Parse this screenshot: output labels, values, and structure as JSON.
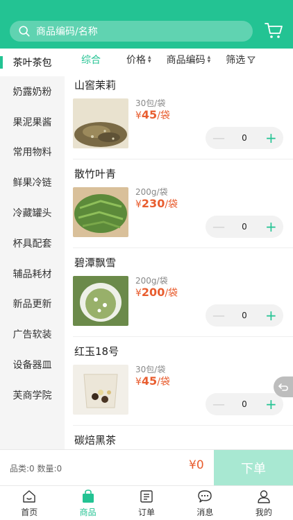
{
  "header": {
    "search_placeholder": "商品编码/名称",
    "search_icon": "search-icon",
    "cart_icon": "cart-icon"
  },
  "filters": {
    "all": "综合",
    "price": "价格",
    "code": "商品编码",
    "filter": "筛选"
  },
  "sidebar": {
    "items": [
      "茶叶茶包",
      "奶露奶粉",
      "果泥果酱",
      "常用物料",
      "鲜果冷链",
      "冷藏罐头",
      "杯具配套",
      "辅品耗材",
      "新品更新",
      "广告软装",
      "设备器皿",
      "芙商学院"
    ],
    "active_index": 0
  },
  "products": [
    {
      "name": "山窖茉莉",
      "spec": "30包/袋",
      "currency": "¥",
      "price": "45",
      "unit": "/袋",
      "qty": "0",
      "image_icon": "tea-leaves-image"
    },
    {
      "name": "散竹叶青",
      "spec": "200g/袋",
      "currency": "¥",
      "price": "230",
      "unit": "/袋",
      "qty": "0",
      "image_icon": "green-tea-image"
    },
    {
      "name": "碧潭飘雪",
      "spec": "200g/袋",
      "currency": "¥",
      "price": "200",
      "unit": "/袋",
      "qty": "0",
      "image_icon": "jasmine-tea-image"
    },
    {
      "name": "红玉18号",
      "spec": "30包/袋",
      "currency": "¥",
      "price": "45",
      "unit": "/袋",
      "qty": "0",
      "image_icon": "tea-bag-image"
    },
    {
      "name": "碳焙黑茶",
      "spec": "",
      "currency": "",
      "price": "",
      "unit": "",
      "qty": "",
      "image_icon": ""
    }
  ],
  "order_bar": {
    "summary": "品类:0 数量:0",
    "total": "¥0",
    "submit_label": "下单"
  },
  "tabbar": {
    "items": [
      {
        "label": "首页",
        "icon": "home-icon"
      },
      {
        "label": "商品",
        "icon": "shopping-bag-icon"
      },
      {
        "label": "订单",
        "icon": "order-list-icon"
      },
      {
        "label": "消息",
        "icon": "message-icon"
      },
      {
        "label": "我的",
        "icon": "user-icon"
      }
    ],
    "active_index": 1
  },
  "colors": {
    "accent": "#23c393",
    "price": "#e85d2f",
    "order_button": "#a8e8d2"
  }
}
